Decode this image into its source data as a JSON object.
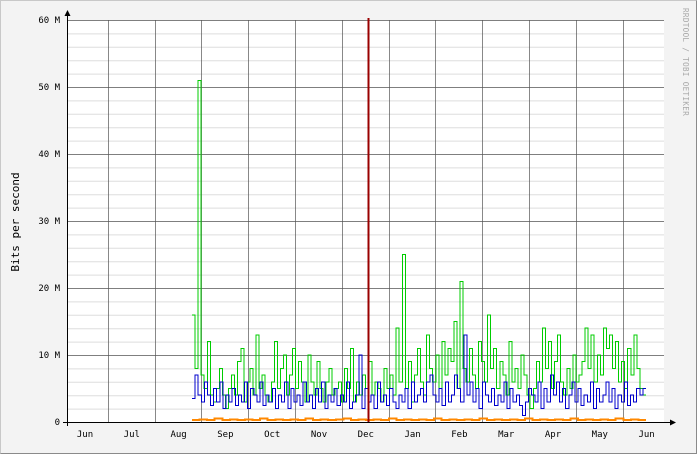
{
  "chart_data": {
    "type": "line",
    "title": "",
    "ylabel": "Bits per second",
    "watermark": "RRDTOOL / TOBI OETIKER",
    "ylim": [
      0,
      60000000
    ],
    "ytick_values": [
      0,
      10000000,
      20000000,
      30000000,
      40000000,
      50000000,
      60000000
    ],
    "ytick_labels": [
      "0",
      "10 M",
      "20 M",
      "30 M",
      "40 M",
      "50 M",
      "60 M"
    ],
    "x_months": [
      "Jun",
      "Jul",
      "Aug",
      "Sep",
      "Oct",
      "Nov",
      "Dec",
      "Jan",
      "Feb",
      "Mar",
      "Apr",
      "May",
      "Jun"
    ],
    "grid": true,
    "legend": "none",
    "marker": {
      "label": "",
      "at_month_index": 6.55,
      "color": "#990000"
    },
    "colors": {
      "background": "#f3f3f3",
      "plot_bg": "#ffffff",
      "major_grid": "#555555",
      "minor_grid": "#dddddd",
      "green": "#00cc00",
      "blue": "#0000cc",
      "orange": "#ff8800"
    },
    "series": [
      {
        "color": "#00cc00",
        "start_month_index": 2.8,
        "end_month_index": 12.5,
        "values": [
          16,
          8,
          51,
          7,
          5,
          12,
          4,
          3,
          5,
          8,
          4,
          2,
          5,
          7,
          4,
          9,
          11,
          3,
          6,
          8,
          4,
          13,
          5,
          7,
          4,
          3,
          6,
          12,
          5,
          8,
          10,
          4,
          7,
          11,
          5,
          9,
          6,
          3,
          10,
          6,
          4,
          9,
          5,
          3,
          6,
          8,
          4,
          5,
          6,
          3,
          8,
          5,
          11,
          3,
          6,
          4,
          7,
          5,
          9,
          4,
          6,
          5,
          3,
          8,
          5,
          7,
          4,
          14,
          6,
          25,
          5,
          9,
          3,
          7,
          11,
          6,
          4,
          13,
          8,
          6,
          10,
          5,
          12,
          7,
          11,
          9,
          15,
          5,
          21,
          8,
          6,
          11,
          7,
          5,
          12,
          9,
          6,
          16,
          8,
          11,
          5,
          9,
          7,
          4,
          12,
          6,
          8,
          5,
          10,
          7,
          4,
          2,
          5,
          9,
          6,
          14,
          8,
          12,
          5,
          9,
          13,
          6,
          4,
          8,
          5,
          10,
          6,
          7,
          9,
          14,
          8,
          13,
          6,
          10,
          7,
          14,
          11,
          13,
          8,
          12,
          6,
          9,
          5,
          11,
          7,
          13,
          8,
          5,
          4
        ]
      },
      {
        "color": "#0000cc",
        "start_month_index": 2.8,
        "end_month_index": 12.5,
        "values": [
          3.5,
          7,
          4,
          3,
          6,
          4,
          2.5,
          5,
          3,
          6,
          2,
          4,
          3,
          5,
          2.5,
          4,
          3,
          6,
          2,
          5,
          4,
          3,
          6,
          2.5,
          4,
          3,
          5,
          2,
          4,
          3,
          6,
          2,
          5,
          3,
          4,
          2.5,
          6,
          3,
          4,
          2,
          5,
          3,
          6,
          2,
          4,
          3,
          5,
          2.5,
          4,
          3,
          6,
          2,
          3,
          4,
          10,
          2,
          5,
          3,
          4,
          2,
          6,
          3,
          4,
          2.5,
          5,
          3,
          2,
          4,
          3,
          5,
          2,
          6,
          3,
          4,
          5,
          3,
          6,
          7,
          4,
          3,
          5,
          2.5,
          6,
          3,
          4,
          7,
          5,
          3,
          13,
          4,
          6,
          3,
          5,
          2,
          6,
          4,
          3,
          5,
          2.5,
          4,
          3,
          6,
          2,
          5,
          3,
          4,
          2.5,
          1,
          3,
          5,
          4,
          3,
          6,
          2,
          5,
          3,
          7,
          4,
          6,
          3,
          5,
          2,
          4,
          6,
          3,
          5,
          2.5,
          4,
          3,
          6,
          2,
          5,
          3,
          4,
          6,
          3,
          5,
          2,
          4,
          3,
          6,
          2.5,
          4,
          3,
          5,
          4,
          5
        ]
      },
      {
        "color": "#ff8800",
        "start_month_index": 2.8,
        "end_month_index": 12.5,
        "values": [
          0.3,
          0.4,
          0.3,
          0.5,
          0.3,
          0.4,
          0.3,
          0.4,
          0.3,
          0.5,
          0.3,
          0.4,
          0.3,
          0.4,
          0.3,
          0.5,
          0.3,
          0.4,
          0.3,
          0.4,
          0.5,
          0.3,
          0.4,
          0.3,
          0.4,
          0.3,
          0.5,
          0.3,
          0.4,
          0.3,
          0.4,
          0.3,
          0.5,
          0.3,
          0.4,
          0.3,
          0.4,
          0.3,
          0.5,
          0.3,
          0.4,
          0.3,
          0.4,
          0.3,
          0.5,
          0.3,
          0.4,
          0.3,
          0.4,
          0.3,
          0.5,
          0.3,
          0.4,
          0.3,
          0.4,
          0.3,
          0.5,
          0.3,
          0.4,
          0.3
        ]
      }
    ]
  }
}
